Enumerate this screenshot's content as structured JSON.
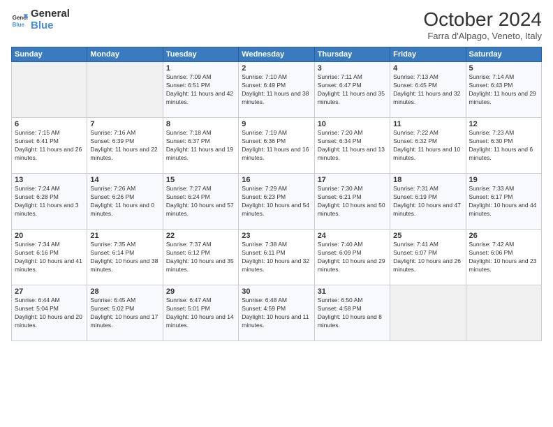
{
  "logo": {
    "line1": "General",
    "line2": "Blue"
  },
  "title": "October 2024",
  "location": "Farra d'Alpago, Veneto, Italy",
  "days_header": [
    "Sunday",
    "Monday",
    "Tuesday",
    "Wednesday",
    "Thursday",
    "Friday",
    "Saturday"
  ],
  "weeks": [
    [
      {
        "day": "",
        "sunrise": "",
        "sunset": "",
        "daylight": ""
      },
      {
        "day": "",
        "sunrise": "",
        "sunset": "",
        "daylight": ""
      },
      {
        "day": "1",
        "sunrise": "Sunrise: 7:09 AM",
        "sunset": "Sunset: 6:51 PM",
        "daylight": "Daylight: 11 hours and 42 minutes."
      },
      {
        "day": "2",
        "sunrise": "Sunrise: 7:10 AM",
        "sunset": "Sunset: 6:49 PM",
        "daylight": "Daylight: 11 hours and 38 minutes."
      },
      {
        "day": "3",
        "sunrise": "Sunrise: 7:11 AM",
        "sunset": "Sunset: 6:47 PM",
        "daylight": "Daylight: 11 hours and 35 minutes."
      },
      {
        "day": "4",
        "sunrise": "Sunrise: 7:13 AM",
        "sunset": "Sunset: 6:45 PM",
        "daylight": "Daylight: 11 hours and 32 minutes."
      },
      {
        "day": "5",
        "sunrise": "Sunrise: 7:14 AM",
        "sunset": "Sunset: 6:43 PM",
        "daylight": "Daylight: 11 hours and 29 minutes."
      }
    ],
    [
      {
        "day": "6",
        "sunrise": "Sunrise: 7:15 AM",
        "sunset": "Sunset: 6:41 PM",
        "daylight": "Daylight: 11 hours and 26 minutes."
      },
      {
        "day": "7",
        "sunrise": "Sunrise: 7:16 AM",
        "sunset": "Sunset: 6:39 PM",
        "daylight": "Daylight: 11 hours and 22 minutes."
      },
      {
        "day": "8",
        "sunrise": "Sunrise: 7:18 AM",
        "sunset": "Sunset: 6:37 PM",
        "daylight": "Daylight: 11 hours and 19 minutes."
      },
      {
        "day": "9",
        "sunrise": "Sunrise: 7:19 AM",
        "sunset": "Sunset: 6:36 PM",
        "daylight": "Daylight: 11 hours and 16 minutes."
      },
      {
        "day": "10",
        "sunrise": "Sunrise: 7:20 AM",
        "sunset": "Sunset: 6:34 PM",
        "daylight": "Daylight: 11 hours and 13 minutes."
      },
      {
        "day": "11",
        "sunrise": "Sunrise: 7:22 AM",
        "sunset": "Sunset: 6:32 PM",
        "daylight": "Daylight: 11 hours and 10 minutes."
      },
      {
        "day": "12",
        "sunrise": "Sunrise: 7:23 AM",
        "sunset": "Sunset: 6:30 PM",
        "daylight": "Daylight: 11 hours and 6 minutes."
      }
    ],
    [
      {
        "day": "13",
        "sunrise": "Sunrise: 7:24 AM",
        "sunset": "Sunset: 6:28 PM",
        "daylight": "Daylight: 11 hours and 3 minutes."
      },
      {
        "day": "14",
        "sunrise": "Sunrise: 7:26 AM",
        "sunset": "Sunset: 6:26 PM",
        "daylight": "Daylight: 11 hours and 0 minutes."
      },
      {
        "day": "15",
        "sunrise": "Sunrise: 7:27 AM",
        "sunset": "Sunset: 6:24 PM",
        "daylight": "Daylight: 10 hours and 57 minutes."
      },
      {
        "day": "16",
        "sunrise": "Sunrise: 7:29 AM",
        "sunset": "Sunset: 6:23 PM",
        "daylight": "Daylight: 10 hours and 54 minutes."
      },
      {
        "day": "17",
        "sunrise": "Sunrise: 7:30 AM",
        "sunset": "Sunset: 6:21 PM",
        "daylight": "Daylight: 10 hours and 50 minutes."
      },
      {
        "day": "18",
        "sunrise": "Sunrise: 7:31 AM",
        "sunset": "Sunset: 6:19 PM",
        "daylight": "Daylight: 10 hours and 47 minutes."
      },
      {
        "day": "19",
        "sunrise": "Sunrise: 7:33 AM",
        "sunset": "Sunset: 6:17 PM",
        "daylight": "Daylight: 10 hours and 44 minutes."
      }
    ],
    [
      {
        "day": "20",
        "sunrise": "Sunrise: 7:34 AM",
        "sunset": "Sunset: 6:16 PM",
        "daylight": "Daylight: 10 hours and 41 minutes."
      },
      {
        "day": "21",
        "sunrise": "Sunrise: 7:35 AM",
        "sunset": "Sunset: 6:14 PM",
        "daylight": "Daylight: 10 hours and 38 minutes."
      },
      {
        "day": "22",
        "sunrise": "Sunrise: 7:37 AM",
        "sunset": "Sunset: 6:12 PM",
        "daylight": "Daylight: 10 hours and 35 minutes."
      },
      {
        "day": "23",
        "sunrise": "Sunrise: 7:38 AM",
        "sunset": "Sunset: 6:11 PM",
        "daylight": "Daylight: 10 hours and 32 minutes."
      },
      {
        "day": "24",
        "sunrise": "Sunrise: 7:40 AM",
        "sunset": "Sunset: 6:09 PM",
        "daylight": "Daylight: 10 hours and 29 minutes."
      },
      {
        "day": "25",
        "sunrise": "Sunrise: 7:41 AM",
        "sunset": "Sunset: 6:07 PM",
        "daylight": "Daylight: 10 hours and 26 minutes."
      },
      {
        "day": "26",
        "sunrise": "Sunrise: 7:42 AM",
        "sunset": "Sunset: 6:06 PM",
        "daylight": "Daylight: 10 hours and 23 minutes."
      }
    ],
    [
      {
        "day": "27",
        "sunrise": "Sunrise: 6:44 AM",
        "sunset": "Sunset: 5:04 PM",
        "daylight": "Daylight: 10 hours and 20 minutes."
      },
      {
        "day": "28",
        "sunrise": "Sunrise: 6:45 AM",
        "sunset": "Sunset: 5:02 PM",
        "daylight": "Daylight: 10 hours and 17 minutes."
      },
      {
        "day": "29",
        "sunrise": "Sunrise: 6:47 AM",
        "sunset": "Sunset: 5:01 PM",
        "daylight": "Daylight: 10 hours and 14 minutes."
      },
      {
        "day": "30",
        "sunrise": "Sunrise: 6:48 AM",
        "sunset": "Sunset: 4:59 PM",
        "daylight": "Daylight: 10 hours and 11 minutes."
      },
      {
        "day": "31",
        "sunrise": "Sunrise: 6:50 AM",
        "sunset": "Sunset: 4:58 PM",
        "daylight": "Daylight: 10 hours and 8 minutes."
      },
      {
        "day": "",
        "sunrise": "",
        "sunset": "",
        "daylight": ""
      },
      {
        "day": "",
        "sunrise": "",
        "sunset": "",
        "daylight": ""
      }
    ]
  ]
}
